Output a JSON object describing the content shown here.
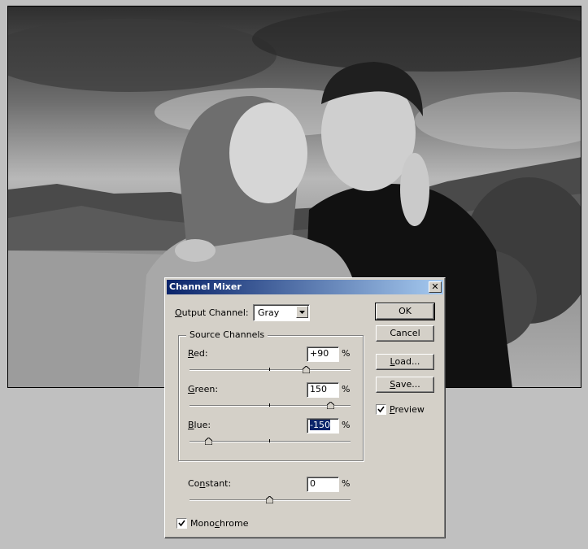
{
  "dialog": {
    "title": "Channel Mixer",
    "output_channel": {
      "label_pre": "",
      "label_key": "O",
      "label_post": "utput Channel:",
      "value": "Gray"
    },
    "source_channels_label": "Source Channels",
    "red": {
      "label_key": "R",
      "label_post": "ed:",
      "value": "+90",
      "unit": "%",
      "level": 90
    },
    "green": {
      "label_key": "G",
      "label_post": "reen:",
      "value": "150",
      "unit": "%",
      "level": 150
    },
    "blue": {
      "label_key": "B",
      "label_post": "lue:",
      "value": "-150",
      "unit": "%",
      "level": -150
    },
    "constant": {
      "label_pre": "Co",
      "label_key": "n",
      "label_post": "stant:",
      "value": "0",
      "unit": "%",
      "level": 0
    },
    "monochrome": {
      "label_pre": "Mono",
      "label_key": "c",
      "label_post": "hrome",
      "checked": true
    },
    "buttons": {
      "ok": "OK",
      "cancel": "Cancel",
      "load": {
        "key": "L",
        "rest": "oad..."
      },
      "save": {
        "key": "S",
        "rest": "ave..."
      }
    },
    "preview": {
      "key": "P",
      "rest": "review",
      "checked": true
    },
    "close_glyph": "✕"
  },
  "colors": {
    "dialog_bg": "#d4d0c8",
    "title_start": "#0a246a",
    "title_end": "#a6caf0",
    "selection": "#0a246a",
    "desktop": "#c0c0c0"
  },
  "photo": {
    "description_icon": "grayscale-photo"
  }
}
